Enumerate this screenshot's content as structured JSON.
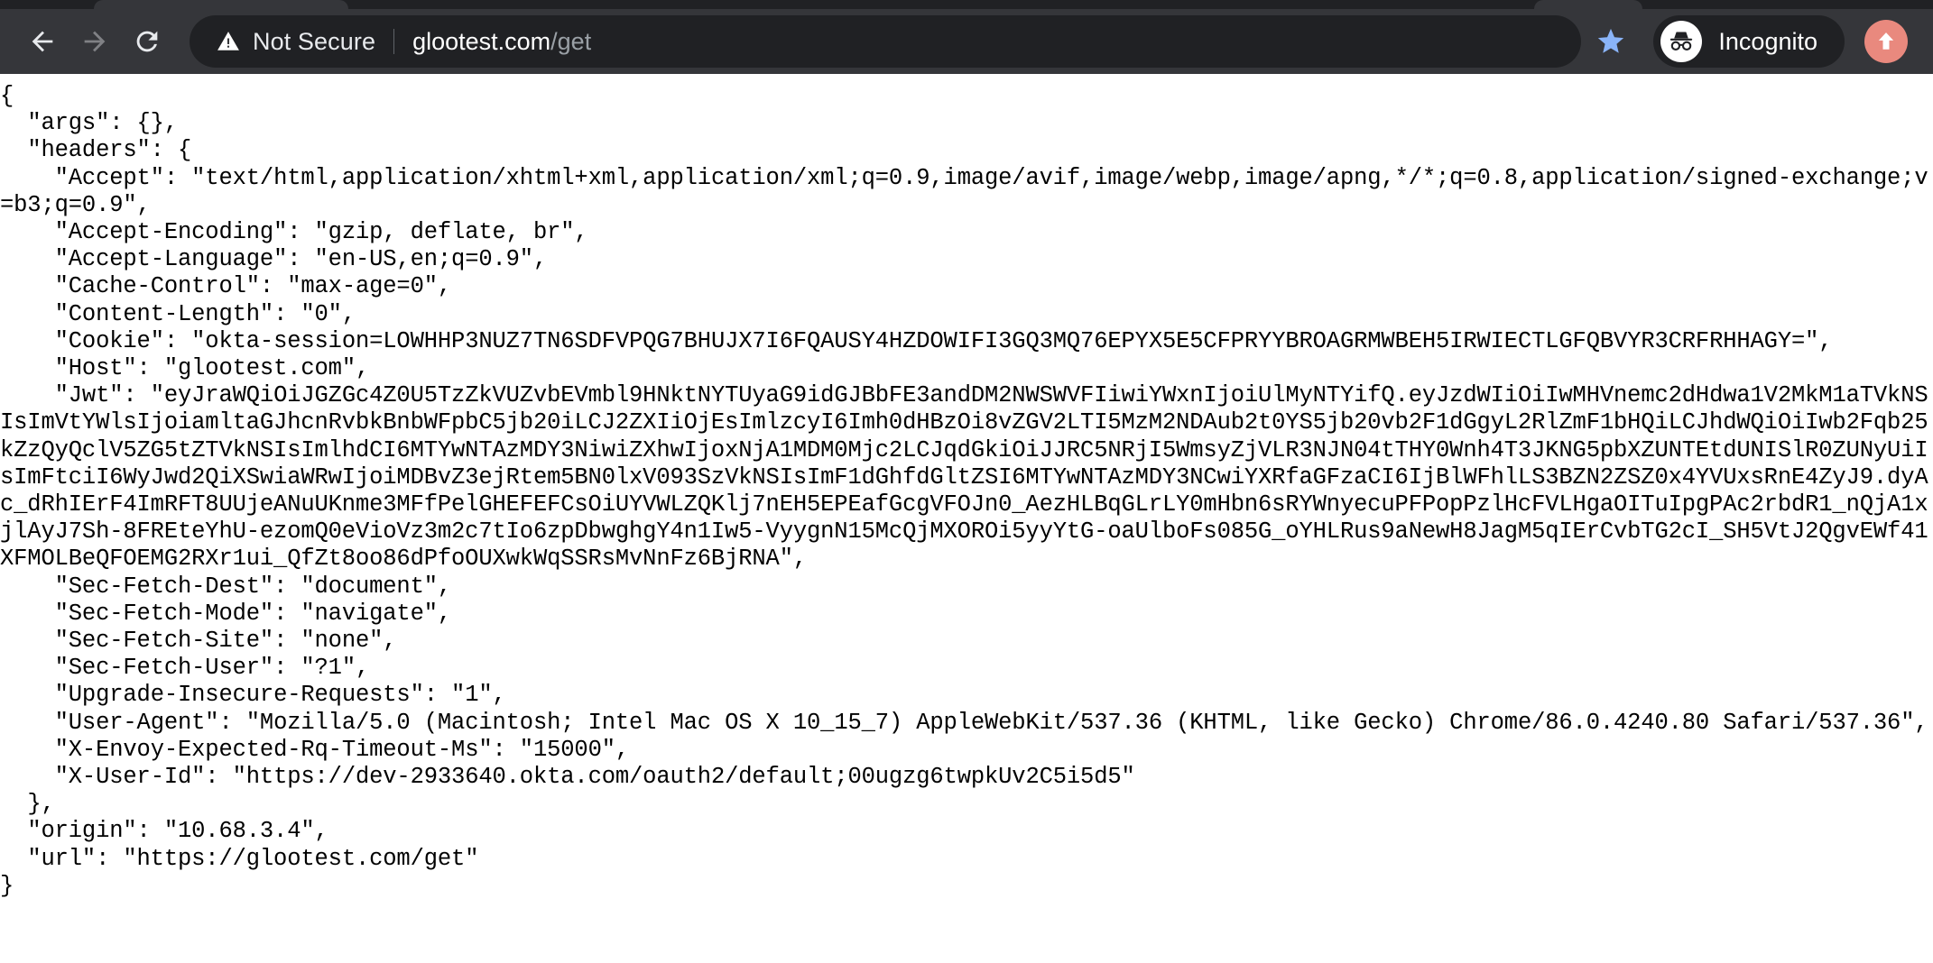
{
  "browser": {
    "back_button": "back-navigation",
    "forward_button": "forward-navigation",
    "reload_button": "reload-page",
    "security_status": "Not Secure",
    "url_host": "glootest.com",
    "url_path": "/get",
    "url_full": "glootest.com/get",
    "bookmark_star": "bookmark-this-page",
    "incognito_label": "Incognito",
    "profile_label": "profile-avatar",
    "colors": {
      "chrome_bg": "#35363a",
      "tabstrip_bg": "#202124",
      "omnibox_bg": "#202124",
      "url_host_color": "#ffffff",
      "url_path_color": "#9aa0a6",
      "star_color": "#8ab4f8",
      "profile_avatar_color": "#e9897e",
      "page_bg": "#ffffff",
      "page_text": "#000000"
    }
  },
  "page": {
    "json_body": "{\n  \"args\": {}, \n  \"headers\": {\n    \"Accept\": \"text/html,application/xhtml+xml,application/xml;q=0.9,image/avif,image/webp,image/apng,*/*;q=0.8,application/signed-exchange;v=b3;q=0.9\", \n    \"Accept-Encoding\": \"gzip, deflate, br\", \n    \"Accept-Language\": \"en-US,en;q=0.9\", \n    \"Cache-Control\": \"max-age=0\", \n    \"Content-Length\": \"0\", \n    \"Cookie\": \"okta-session=LOWHHP3NUZ7TN6SDFVPQG7BHUJX7I6FQAUSY4HZDOWIFI3GQ3MQ76EPYX5E5CFPRYYBROAGRMWBEH5IRWIECTLGFQBVYR3CRFRHHAGY=\", \n    \"Host\": \"glootest.com\", \n    \"Jwt\": \"eyJraWQiOiJGZGc4Z0U5TzZkVUZvbEVmbl9HNktNYTUyaG9idGJBbFE3andDM2NWSWVFIiwiYWxnIjoiUlMyNTYifQ.eyJzdWIiOiIwMHVnemc2dHdwa1V2MkM1aTVkNSIsImVtYWlsIjoiamltaGJhcnRvbkBnbWFpbC5jb20iLCJ2ZXIiOjEsImlzcyI6Imh0dHBzOi8vZGV2LTI5MzM2NDAub2t0YS5jb20vb2F1dGgyL2RlZmF1bHQiLCJhdWQiOiIwb2Fqb25kZzQyQclV5ZG5tZTVkNSIsImlhdCI6MTYwNTAzMDY3NiwiZXhwIjoxNjA1MDM0Mjc2LCJqdGkiOiJJRC5NRjI5WmsyZjVLR3NJN04tTHY0Wnh4T3JKNG5pbXZUNTEtdUNISlR0ZUNyUiIsImFtciI6WyJwd2QiXSwiaWRwIjoiMDBvZ3ejRtem5BN0lxV093SzVkNSIsImF1dGhfdGltZSI6MTYwNTAzMDY3NCwiYXRfaGFzaCI6IjBlWFhlLS3BZN2ZSZ0x4YVUxsRnE4ZyJ9.dyAc_dRhIErF4ImRFT8UUjeANuUKnme3MFfPelGHEFEFCsOiUYVWLZQKlj7nEH5EPEafGcgVFOJn0_AezHLBqGLrLY0mHbn6sRYWnyecuPFPopPzlHcFVLHgaOITuIpgPAc2rbdR1_nQjA1xjlAyJ7Sh-8FREteYhU-ezomQ0eVioVz3m2c7tIo6zpDbwghgY4n1Iw5-VyygnN15McQjMXOROi5yyYtG-oaUlboFs085G_oYHLRus9aNewH8JagM5qIErCvbTG2cI_SH5VtJ2QgvEWf41XFMOLBeQFOEMG2RXr1ui_QfZt8oo86dPfoOUXwkWqSSRsMvNnFz6BjRNA\", \n    \"Sec-Fetch-Dest\": \"document\", \n    \"Sec-Fetch-Mode\": \"navigate\", \n    \"Sec-Fetch-Site\": \"none\", \n    \"Sec-Fetch-User\": \"?1\", \n    \"Upgrade-Insecure-Requests\": \"1\", \n    \"User-Agent\": \"Mozilla/5.0 (Macintosh; Intel Mac OS X 10_15_7) AppleWebKit/537.36 (KHTML, like Gecko) Chrome/86.0.4240.80 Safari/537.36\", \n    \"X-Envoy-Expected-Rq-Timeout-Ms\": \"15000\", \n    \"X-User-Id\": \"https://dev-2933640.okta.com/oauth2/default;00ugzg6twpkUv2C5i5d5\"\n  }, \n  \"origin\": \"10.68.3.4\", \n  \"url\": \"https://glootest.com/get\"\n}",
    "fields": {
      "args": "{}",
      "accept": "text/html,application/xhtml+xml,application/xml;q=0.9,image/avif,image/webp,image/apng,*/*;q=0.8,application/signed-exchange;v=b3;q=0.9",
      "accept_encoding": "gzip, deflate, br",
      "accept_language": "en-US,en;q=0.9",
      "cache_control": "max-age=0",
      "content_length": "0",
      "cookie": "okta-session=LOWHHP3NUZ7TN6SDFVPQG7BHUJX7I6FQAUSY4HZDOWIFI3GQ3MQ76EPYX5E5CFPRYYBROAGRMWBEH5IRWIECTLGFQBVYR3CRFRHHAGY=",
      "host": "glootest.com",
      "sec_fetch_dest": "document",
      "sec_fetch_mode": "navigate",
      "sec_fetch_site": "none",
      "sec_fetch_user": "?1",
      "upgrade_insecure_requests": "1",
      "user_agent": "Mozilla/5.0 (Macintosh; Intel Mac OS X 10_15_7) AppleWebKit/537.36 (KHTML, like Gecko) Chrome/86.0.4240.80 Safari/537.36",
      "x_envoy_expected_rq_timeout_ms": "15000",
      "x_user_id": "https://dev-2933640.okta.com/oauth2/default;00ugzg6twpkUv2C5i5d5",
      "origin": "10.68.3.4",
      "url": "https://glootest.com/get"
    }
  }
}
